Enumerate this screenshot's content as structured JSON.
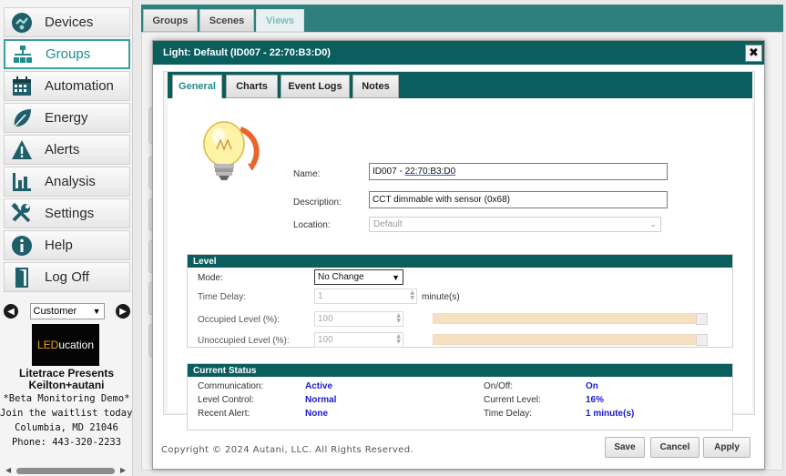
{
  "sidebar": {
    "items": [
      {
        "label": "Devices",
        "icon": "devices-icon",
        "active": false
      },
      {
        "label": "Groups",
        "icon": "groups-icon",
        "active": true
      },
      {
        "label": "Automation",
        "icon": "automation-icon",
        "active": false
      },
      {
        "label": "Energy",
        "icon": "leaf-icon",
        "active": false
      },
      {
        "label": "Alerts",
        "icon": "alert-icon",
        "active": false
      },
      {
        "label": "Analysis",
        "icon": "bar-chart-icon",
        "active": false
      },
      {
        "label": "Settings",
        "icon": "tools-icon",
        "active": false
      },
      {
        "label": "Help",
        "icon": "info-icon",
        "active": false
      },
      {
        "label": "Log Off",
        "icon": "door-icon",
        "active": false
      }
    ],
    "customer_select": "Customer",
    "logo_led": "LED",
    "logo_rest": "ucation",
    "promo": {
      "line1": "Litetrace Presents",
      "line2": "Keilton+autani",
      "line3": "*Beta Monitoring Demo*",
      "line4": "Join the waitlist today!",
      "line5": "Columbia, MD  21046",
      "line6": "Phone: 443-320-2233"
    }
  },
  "top_tabs": [
    "Groups",
    "Scenes",
    "Views"
  ],
  "dialog": {
    "title": "Light: Default (ID007 - 22:70:B3:D0)",
    "close_label": "✖",
    "tabs": [
      "General",
      "Charts",
      "Event Logs",
      "Notes"
    ],
    "general": {
      "name_label": "Name:",
      "name_prefix": "ID007 - ",
      "name_mac": "22:70:B3:D0",
      "description_label": "Description:",
      "description_value": "CCT dimmable with sensor (0x68)",
      "location_label": "Location:",
      "location_value": "Default"
    },
    "level": {
      "header": "Level",
      "mode_label": "Mode:",
      "mode_value": "No Change",
      "time_delay_label": "Time Delay:",
      "time_delay_value": "1",
      "time_delay_unit": "minute(s)",
      "occupied_label": "Occupied Level (%):",
      "occupied_value": "100",
      "unoccupied_label": "Unoccupied Level (%):",
      "unoccupied_value": "100"
    },
    "status": {
      "header": "Current Status",
      "rows": [
        {
          "label": "Communication:",
          "value": "Active",
          "label2": "On/Off:",
          "value2": "On"
        },
        {
          "label": "Level Control:",
          "value": "Normal",
          "label2": "Current Level:",
          "value2": "16%"
        },
        {
          "label": "Recent Alert:",
          "value": "None",
          "label2": "Time Delay:",
          "value2": "1 minute(s)"
        }
      ]
    },
    "copyright": "Copyright © 2024 Autani, LLC. All Rights Reserved.",
    "buttons": {
      "save": "Save",
      "cancel": "Cancel",
      "apply": "Apply"
    }
  },
  "colors": {
    "teal_dark": "#0b5e5e",
    "teal_strip": "#2f7f7f",
    "accent": "#1f8d8d",
    "status_blue": "#1a1ad0",
    "slider": "#f6e0c0"
  }
}
